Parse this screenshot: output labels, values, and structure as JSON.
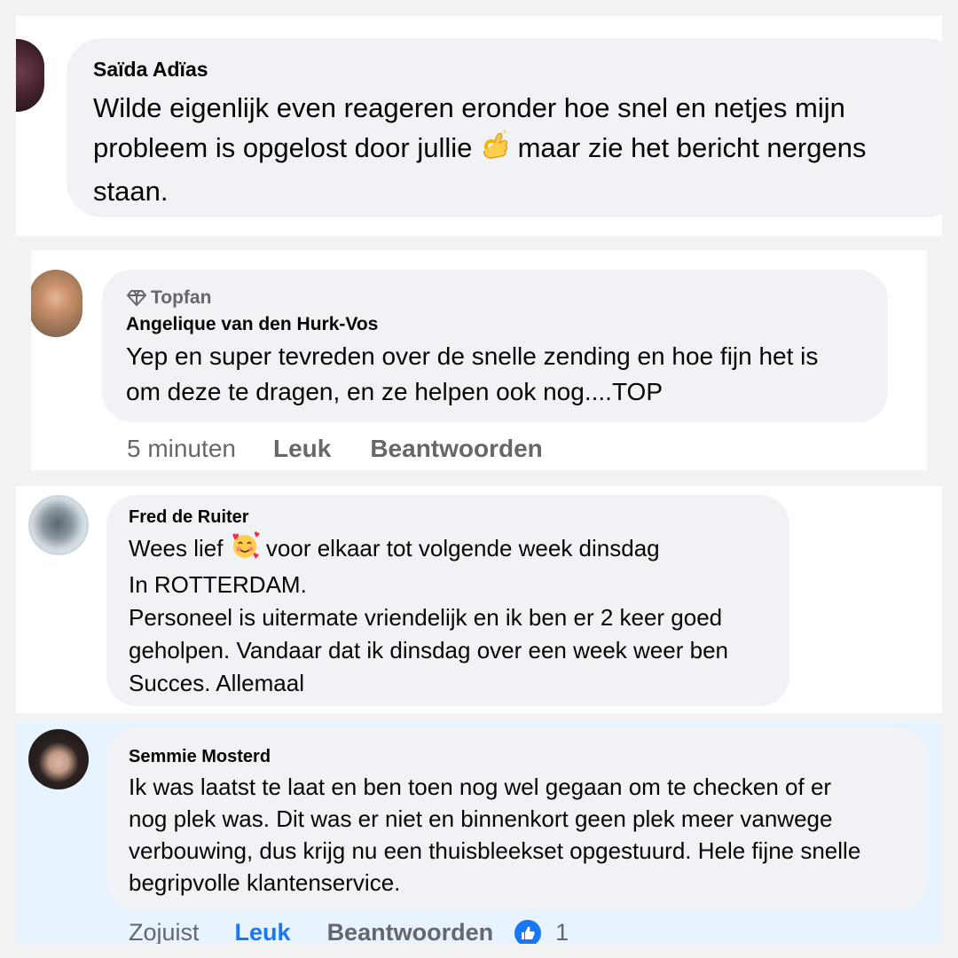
{
  "comments": [
    {
      "author": "Saïda Adïas",
      "text_before": "Wilde eigenlijk even reageren eronder hoe snel en netjes mijn\nprobleem is opgelost door jullie ",
      "emoji": "ok-hand-emoji",
      "text_after": " maar zie het bericht nergens\nstaan."
    },
    {
      "badge": "Topfan",
      "author": "Angelique van den Hurk-Vos",
      "text": "Yep en super tevreden over de snelle zending en hoe fijn het is\nom deze te dragen, en ze helpen ook nog....TOP",
      "time": "5 minuten",
      "like_label": "Leuk",
      "reply_label": "Beantwoorden"
    },
    {
      "author": "Fred de Ruiter",
      "text_before": "Wees lief ",
      "emoji": "smiling-face-with-hearts-emoji",
      "text_after": " voor elkaar tot volgende week dinsdag\nIn ROTTERDAM.\nPersoneel is uitermate vriendelijk en ik ben er 2 keer goed\ngeholpen. Vandaar dat ik dinsdag over een week weer ben\nSucces. Allemaal"
    },
    {
      "author": "Semmie Mosterd",
      "text": "Ik was laatst te laat en ben toen nog wel gegaan om te checken of er\nnog plek was. Dit was er niet en binnenkort geen plek meer vanwege\nverbouwing, dus krijg nu een thuisbleekset opgestuurd. Hele fijne snelle\nbegripvolle klantenservice.",
      "time": "Zojuist",
      "like_label": "Leuk",
      "reply_label": "Beantwoorden",
      "reaction_count": "1"
    }
  ],
  "colors": {
    "bubble": "#f0f2f5",
    "highlight_bg": "#e7f3ff",
    "secondary_text": "#65676b",
    "facebook_blue": "#1877f2"
  }
}
